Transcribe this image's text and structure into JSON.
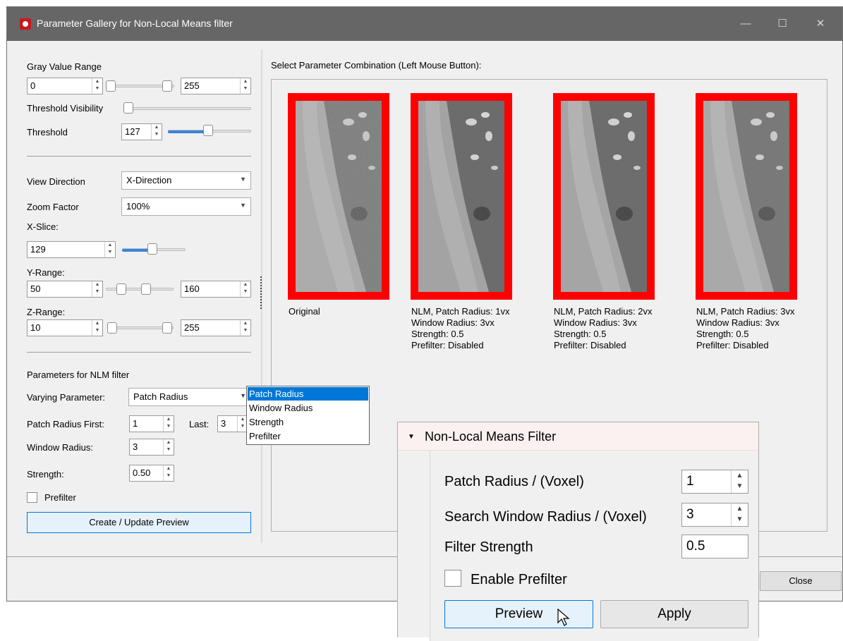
{
  "window": {
    "title": "Parameter Gallery for Non-Local Means filter",
    "close_button": "Close"
  },
  "left_panel": {
    "gray_value_range": {
      "label": "Gray Value Range",
      "min": "0",
      "max": "255"
    },
    "threshold_visibility": {
      "label": "Threshold Visibility"
    },
    "threshold": {
      "label": "Threshold",
      "value": "127"
    },
    "view_direction": {
      "label": "View Direction",
      "value": "X-Direction"
    },
    "zoom_factor": {
      "label": "Zoom Factor",
      "value": "100%"
    },
    "x_slice": {
      "label": "X-Slice:",
      "value": "129"
    },
    "y_range": {
      "label": "Y-Range:",
      "min": "50",
      "max": "160"
    },
    "z_range": {
      "label": "Z-Range:",
      "min": "10",
      "max": "255"
    },
    "nlm": {
      "section_title": "Parameters for NLM filter",
      "varying_parameter_label": "Varying Parameter:",
      "varying_parameter_value": "Patch Radius",
      "patch_radius_first_label": "Patch Radius First:",
      "patch_radius_first": "1",
      "last_label": "Last:",
      "last": "3",
      "window_radius_label": "Window Radius:",
      "window_radius": "3",
      "strength_label": "Strength:",
      "strength": "0.50",
      "prefilter_label": "Prefilter",
      "create_button": "Create / Update Preview"
    }
  },
  "dropdown_options": [
    "Patch Radius",
    "Window Radius",
    "Strength",
    "Prefilter"
  ],
  "gallery": {
    "heading": "Select Parameter Combination (Left Mouse Button):",
    "items": [
      {
        "lines": [
          "Original"
        ]
      },
      {
        "lines": [
          "NLM, Patch Radius: 1vx",
          "Window Radius: 3vx",
          "Strength: 0.5",
          "Prefilter: Disabled"
        ]
      },
      {
        "lines": [
          "NLM, Patch Radius: 2vx",
          "Window Radius: 3vx",
          "Strength: 0.5",
          "Prefilter: Disabled"
        ]
      },
      {
        "lines": [
          "NLM, Patch Radius: 3vx",
          "Window Radius: 3vx",
          "Strength: 0.5",
          "Prefilter: Disabled"
        ]
      }
    ]
  },
  "overlay": {
    "title": "Non-Local Means Filter",
    "patch_radius_label": "Patch Radius / (Voxel)",
    "patch_radius": "1",
    "search_window_label": "Search Window Radius / (Voxel)",
    "search_window": "3",
    "filter_strength_label": "Filter Strength",
    "filter_strength": "0.5",
    "enable_prefilter_label": "Enable Prefilter",
    "preview_button": "Preview",
    "apply_button": "Apply"
  },
  "colors": {
    "titlebar": "#666666",
    "thumb_border": "#ff0000",
    "accent": "#0078d7",
    "slider_fill": "#3b84d9"
  }
}
